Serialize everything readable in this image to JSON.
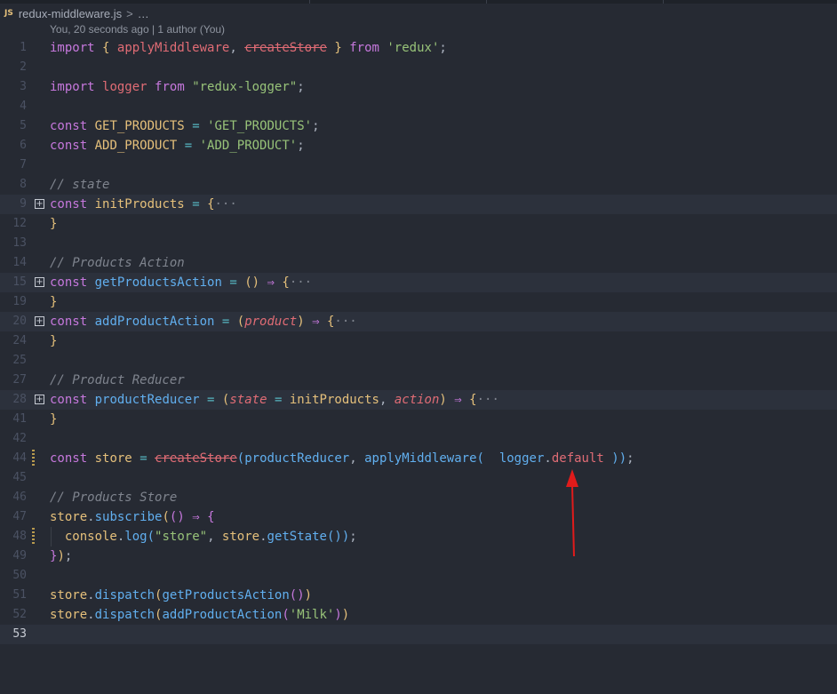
{
  "breadcrumb": {
    "lang_badge": "JS",
    "file_name": "redux-middleware.js",
    "separator": ">",
    "trail": "…"
  },
  "codelens": {
    "text": "You, 20 seconds ago | 1 author (You)"
  },
  "code_lines": [
    {
      "num": "1",
      "tokens": [
        [
          "k",
          "import"
        ],
        [
          "p",
          " "
        ],
        [
          "y",
          "{"
        ],
        [
          "p",
          " "
        ],
        [
          "r",
          "applyMiddleware"
        ],
        [
          "p",
          ", "
        ],
        [
          "strike",
          "createStore"
        ],
        [
          "p",
          " "
        ],
        [
          "y",
          "}"
        ],
        [
          "p",
          " "
        ],
        [
          "k",
          "from"
        ],
        [
          "p",
          " "
        ],
        [
          "s",
          "'redux'"
        ],
        [
          "p",
          ";"
        ]
      ]
    },
    {
      "num": "2",
      "tokens": []
    },
    {
      "num": "3",
      "tokens": [
        [
          "k",
          "import"
        ],
        [
          "p",
          " "
        ],
        [
          "r",
          "logger"
        ],
        [
          "p",
          " "
        ],
        [
          "k",
          "from"
        ],
        [
          "p",
          " "
        ],
        [
          "s",
          "\"redux-logger\""
        ],
        [
          "p",
          ";"
        ]
      ]
    },
    {
      "num": "4",
      "tokens": []
    },
    {
      "num": "5",
      "tokens": [
        [
          "k",
          "const"
        ],
        [
          "p",
          " "
        ],
        [
          "v",
          "GET_PRODUCTS"
        ],
        [
          "p",
          " "
        ],
        [
          "o",
          "="
        ],
        [
          "p",
          " "
        ],
        [
          "s",
          "'GET_PRODUCTS'"
        ],
        [
          "p",
          ";"
        ]
      ]
    },
    {
      "num": "6",
      "tokens": [
        [
          "k",
          "const"
        ],
        [
          "p",
          " "
        ],
        [
          "v",
          "ADD_PRODUCT"
        ],
        [
          "p",
          " "
        ],
        [
          "o",
          "="
        ],
        [
          "p",
          " "
        ],
        [
          "s",
          "'ADD_PRODUCT'"
        ],
        [
          "p",
          ";"
        ]
      ]
    },
    {
      "num": "7",
      "tokens": []
    },
    {
      "num": "8",
      "tokens": [
        [
          "c",
          "// state"
        ]
      ]
    },
    {
      "num": "9",
      "fold": true,
      "hl": true,
      "tokens": [
        [
          "k",
          "const"
        ],
        [
          "p",
          " "
        ],
        [
          "v",
          "initProducts"
        ],
        [
          "p",
          " "
        ],
        [
          "o",
          "="
        ],
        [
          "p",
          " "
        ],
        [
          "y",
          "{"
        ],
        [
          "ell",
          "···"
        ]
      ]
    },
    {
      "num": "12",
      "tokens": [
        [
          "y",
          "}"
        ]
      ]
    },
    {
      "num": "13",
      "tokens": []
    },
    {
      "num": "14",
      "tokens": [
        [
          "c",
          "// Products Action"
        ]
      ]
    },
    {
      "num": "15",
      "fold": true,
      "hl": true,
      "tokens": [
        [
          "k",
          "const"
        ],
        [
          "p",
          " "
        ],
        [
          "f",
          "getProductsAction"
        ],
        [
          "p",
          " "
        ],
        [
          "o",
          "="
        ],
        [
          "p",
          " "
        ],
        [
          "y",
          "()"
        ],
        [
          "p",
          " "
        ],
        [
          "k",
          "⇒"
        ],
        [
          "p",
          " "
        ],
        [
          "y",
          "{"
        ],
        [
          "ell",
          "···"
        ]
      ]
    },
    {
      "num": "19",
      "tokens": [
        [
          "y",
          "}"
        ]
      ]
    },
    {
      "num": "20",
      "fold": true,
      "hl": true,
      "tokens": [
        [
          "k",
          "const"
        ],
        [
          "p",
          " "
        ],
        [
          "f",
          "addProductAction"
        ],
        [
          "p",
          " "
        ],
        [
          "o",
          "="
        ],
        [
          "p",
          " "
        ],
        [
          "y",
          "("
        ],
        [
          "ip",
          "product"
        ],
        [
          "y",
          ")"
        ],
        [
          "p",
          " "
        ],
        [
          "k",
          "⇒"
        ],
        [
          "p",
          " "
        ],
        [
          "y",
          "{"
        ],
        [
          "ell",
          "···"
        ]
      ]
    },
    {
      "num": "24",
      "tokens": [
        [
          "y",
          "}"
        ]
      ]
    },
    {
      "num": "25",
      "tokens": []
    },
    {
      "num": "27",
      "tokens": [
        [
          "c",
          "// Product Reducer"
        ]
      ]
    },
    {
      "num": "28",
      "fold": true,
      "hl": true,
      "tokens": [
        [
          "k",
          "const"
        ],
        [
          "p",
          " "
        ],
        [
          "f",
          "productReducer"
        ],
        [
          "p",
          " "
        ],
        [
          "o",
          "="
        ],
        [
          "p",
          " "
        ],
        [
          "y",
          "("
        ],
        [
          "ip",
          "state"
        ],
        [
          "p",
          " "
        ],
        [
          "o",
          "="
        ],
        [
          "p",
          " "
        ],
        [
          "v",
          "initProducts"
        ],
        [
          "p",
          ", "
        ],
        [
          "ip",
          "action"
        ],
        [
          "y",
          ")"
        ],
        [
          "p",
          " "
        ],
        [
          "k",
          "⇒"
        ],
        [
          "p",
          " "
        ],
        [
          "y",
          "{"
        ],
        [
          "ell",
          "···"
        ]
      ]
    },
    {
      "num": "41",
      "tokens": [
        [
          "y",
          "}"
        ]
      ]
    },
    {
      "num": "42",
      "tokens": []
    },
    {
      "num": "44",
      "mod": true,
      "tokens": [
        [
          "k",
          "const"
        ],
        [
          "p",
          " "
        ],
        [
          "v",
          "store"
        ],
        [
          "p",
          " "
        ],
        [
          "o",
          "="
        ],
        [
          "p",
          " "
        ],
        [
          "strike",
          "createStore"
        ],
        [
          "f",
          "("
        ],
        [
          "f",
          "productReducer"
        ],
        [
          "p",
          ", "
        ],
        [
          "f",
          "applyMiddleware"
        ],
        [
          "f",
          "("
        ],
        [
          "p",
          "  "
        ],
        [
          "f",
          "logger"
        ],
        [
          "p",
          "."
        ],
        [
          "r",
          "default"
        ],
        [
          "p",
          " "
        ],
        [
          "f",
          ")"
        ],
        [
          "f",
          ")"
        ],
        [
          "p",
          ";"
        ]
      ]
    },
    {
      "num": "45",
      "tokens": []
    },
    {
      "num": "46",
      "tokens": [
        [
          "c",
          "// Products Store"
        ]
      ]
    },
    {
      "num": "47",
      "tokens": [
        [
          "v",
          "store"
        ],
        [
          "p",
          "."
        ],
        [
          "f",
          "subscribe"
        ],
        [
          "y",
          "("
        ],
        [
          "k",
          "()"
        ],
        [
          "p",
          " "
        ],
        [
          "k",
          "⇒"
        ],
        [
          "p",
          " "
        ],
        [
          "k",
          "{"
        ]
      ]
    },
    {
      "num": "48",
      "mod": true,
      "guide": true,
      "tokens": [
        [
          "p",
          "  "
        ],
        [
          "v",
          "console"
        ],
        [
          "p",
          "."
        ],
        [
          "f",
          "log"
        ],
        [
          "f",
          "("
        ],
        [
          "s",
          "\"store\""
        ],
        [
          "p",
          ", "
        ],
        [
          "v",
          "store"
        ],
        [
          "p",
          "."
        ],
        [
          "f",
          "getState"
        ],
        [
          "f",
          "()"
        ],
        [
          "f",
          ")"
        ],
        [
          "p",
          ";"
        ]
      ]
    },
    {
      "num": "49",
      "tokens": [
        [
          "k",
          "}"
        ],
        [
          "y",
          ")"
        ],
        [
          "p",
          ";"
        ]
      ]
    },
    {
      "num": "50",
      "tokens": []
    },
    {
      "num": "51",
      "tokens": [
        [
          "v",
          "store"
        ],
        [
          "p",
          "."
        ],
        [
          "f",
          "dispatch"
        ],
        [
          "y",
          "("
        ],
        [
          "f",
          "getProductsAction"
        ],
        [
          "k",
          "()"
        ],
        [
          "y",
          ")"
        ]
      ]
    },
    {
      "num": "52",
      "tokens": [
        [
          "v",
          "store"
        ],
        [
          "p",
          "."
        ],
        [
          "f",
          "dispatch"
        ],
        [
          "y",
          "("
        ],
        [
          "f",
          "addProductAction"
        ],
        [
          "k",
          "("
        ],
        [
          "s",
          "'Milk'"
        ],
        [
          "k",
          ")"
        ],
        [
          "y",
          ")"
        ]
      ]
    },
    {
      "num": "53",
      "active": true,
      "hl": true,
      "tokens": []
    }
  ],
  "colors": {
    "background": "#262a33",
    "annotation_arrow": "#e01b1b",
    "keyword": "#c678dd",
    "function": "#61afef",
    "string": "#98c379",
    "comment": "#7f848e"
  }
}
